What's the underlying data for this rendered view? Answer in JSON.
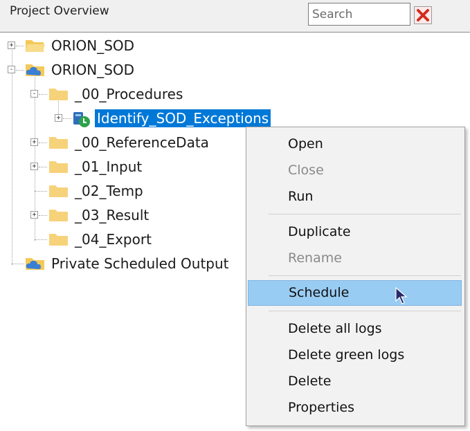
{
  "header": {
    "title": "Project Overview",
    "search_placeholder": "Search",
    "search_value": "",
    "clear_icon": "red-x-icon"
  },
  "tree": {
    "items": [
      {
        "label": "ORION_SOD",
        "icon": "folder-open-icon",
        "expander": "+"
      },
      {
        "label": "ORION_SOD",
        "icon": "cloud-folder-icon",
        "expander": "-"
      },
      {
        "label": "_00_Procedures",
        "icon": "folder-icon",
        "expander": "-"
      },
      {
        "label": "Identify_SOD_Exceptions",
        "icon": "procedure-icon",
        "expander": "+",
        "selected": true
      },
      {
        "label": "_00_ReferenceData",
        "icon": "folder-icon",
        "expander": "+"
      },
      {
        "label": "_01_Input",
        "icon": "folder-icon",
        "expander": "+"
      },
      {
        "label": "_02_Temp",
        "icon": "folder-icon",
        "expander": ""
      },
      {
        "label": "_03_Result",
        "icon": "folder-icon",
        "expander": "+"
      },
      {
        "label": "_04_Export",
        "icon": "folder-icon",
        "expander": ""
      },
      {
        "label": "Private Scheduled Output",
        "icon": "cloud-folder-icon",
        "expander": ""
      }
    ]
  },
  "context_menu": {
    "items": [
      {
        "label": "Open",
        "enabled": true
      },
      {
        "label": "Close",
        "enabled": false
      },
      {
        "label": "Run",
        "enabled": true
      },
      {
        "label": "Duplicate",
        "enabled": true
      },
      {
        "label": "Rename",
        "enabled": false
      },
      {
        "label": "Schedule",
        "enabled": true,
        "highlighted": true
      },
      {
        "label": "Delete all logs",
        "enabled": true
      },
      {
        "label": "Delete green logs",
        "enabled": true
      },
      {
        "label": "Delete",
        "enabled": true
      },
      {
        "label": "Properties",
        "enabled": true
      }
    ]
  },
  "colors": {
    "selection": "#0078d7",
    "menu_highlight": "#99ccf3",
    "folder": "#f6d27a",
    "cloud": "#3b7fd4"
  }
}
